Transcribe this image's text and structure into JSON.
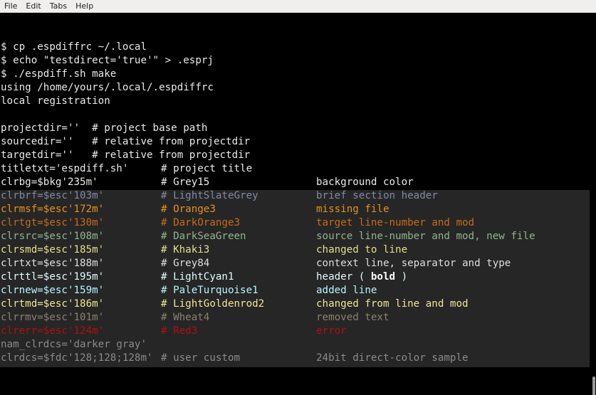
{
  "menu": {
    "items": [
      "File",
      "Edit",
      "Tabs",
      "Help"
    ]
  },
  "terminal": {
    "lines": [
      {
        "text": "$ cp .espdiffrc ~/.local"
      },
      {
        "text": "$ echo \"testdirect='true'\" > .esprj"
      },
      {
        "text": "$ ./espdiff.sh make"
      },
      {
        "text": "using /home/yours/.local/.espdiffrc"
      },
      {
        "text": "local registration"
      },
      {
        "text": ""
      },
      {
        "text": "projectdir=''  # project base path"
      },
      {
        "text": "sourcedir=''   # relative from projectdir"
      },
      {
        "text": "targetdir=''   # relative from projectdir"
      }
    ],
    "table_rows": [
      {
        "c1": "titletxt='espdiff.sh'",
        "c2": "# project title",
        "c3": "",
        "color": "#eaeaea",
        "panel": false
      },
      {
        "c1": "clrbg=$bkg'235m'",
        "c2": "# Grey15",
        "c3": "background color",
        "color": "#eaeaea",
        "panel": false
      },
      {
        "c1": "clrbrf=$esc'103m'",
        "c2": "# LightSlateGrey",
        "c3": "brief section header",
        "color": "#8288a8",
        "panel": true
      },
      {
        "c1": "clrmsf=$esc'172m'",
        "c2": "# Orange3",
        "c3": "missing file",
        "color": "#e5921b",
        "panel": true
      },
      {
        "c1": "clrtgt=$esc'130m'",
        "c2": "# DarkOrange3",
        "c3": "target line-number and mod",
        "color": "#c66b18",
        "panel": true
      },
      {
        "c1": "clrsrc=$esc'108m'",
        "c2": "# DarkSeaGreen",
        "c3": "source line-number and mod, new file",
        "color": "#8fb58c",
        "panel": true
      },
      {
        "c1": "clrsmd=$esc'185m'",
        "c2": "# Khaki3",
        "c3": "changed to line",
        "color": "#e6df8a",
        "panel": true
      },
      {
        "c1": "clrtxt=$esc'188m'",
        "c2": "# Grey84",
        "c3": "context line, separator and type",
        "color": "#dedede",
        "panel": true
      },
      {
        "c1": "clrttl=$esc'195m'",
        "c2": "# LightCyan1",
        "c3": "header ( ",
        "c3bold": "bold",
        "c3tail": " )",
        "color": "#e4fbff",
        "panel": true
      },
      {
        "c1": "clrnew=$esc'159m'",
        "c2": "# PaleTurquoise1",
        "c3": "added line",
        "color": "#b5f5ff",
        "panel": true
      },
      {
        "c1": "clrtmd=$esc'186m'",
        "c2": "# LightGoldenrod2",
        "c3": "changed from line and mod",
        "color": "#efe596",
        "panel": true
      },
      {
        "c1": "clrrmv=$esc'101m'",
        "c2": "# Wheat4",
        "c3": "removed text",
        "color": "#8a8070",
        "panel": true
      },
      {
        "c1": "clrerr=$esc'124m'",
        "c2": "# Red3",
        "c3": "error",
        "color": "#b01010",
        "panel": true
      },
      {
        "c1": "nam_clrdcs='darker gray'",
        "c2": "",
        "c3": "",
        "color": "#8a8a8a",
        "panel": true
      },
      {
        "c1": "clrdcs=$fdc'128;128;128m'",
        "c2": "# user custom",
        "c3": "24bit direct-color sample",
        "color": "#8a8a8a",
        "panel": true
      }
    ]
  },
  "colors": {
    "terminal_bg": "#000000",
    "panel_bg": "#262626",
    "menubar_bg": "#f0efee",
    "default_fg": "#eaeaea"
  }
}
